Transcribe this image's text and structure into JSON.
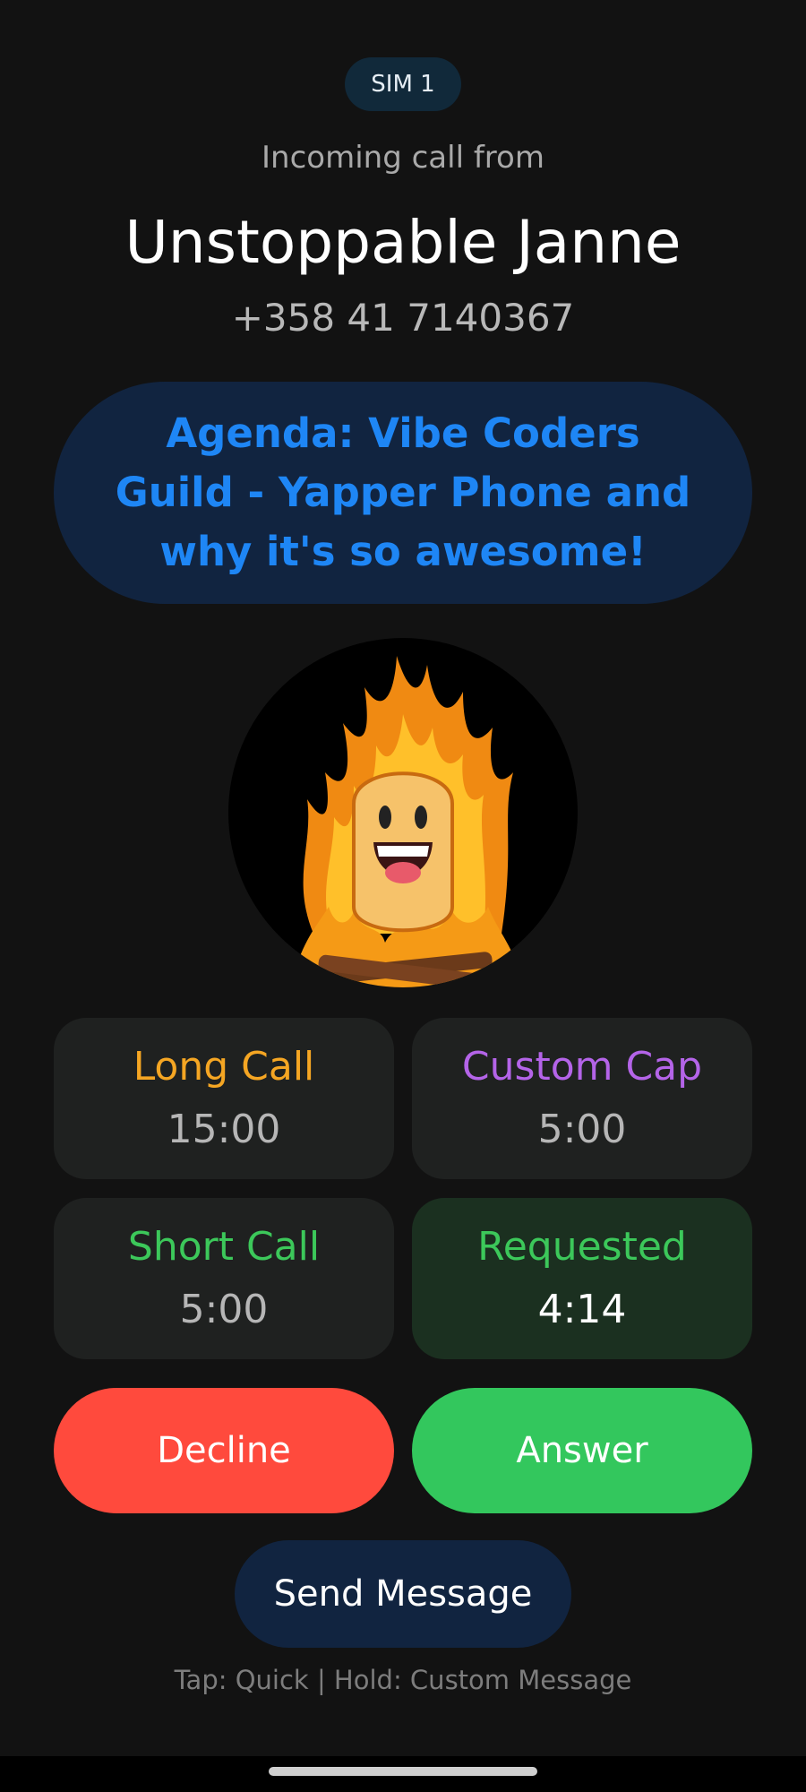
{
  "sim": {
    "label": "SIM 1"
  },
  "call": {
    "incoming_label": "Incoming call from",
    "caller_name": "Unstoppable Janne",
    "caller_number": "+358 41 7140367",
    "agenda": "Agenda: Vibe Coders Guild - Yapper Phone and why it's so awesome!"
  },
  "caps": [
    {
      "title": "Long Call",
      "time": "15:00",
      "color": "#f5a623"
    },
    {
      "title": "Custom Cap",
      "time": "5:00",
      "color": "#b464e8"
    },
    {
      "title": "Short Call",
      "time": "5:00",
      "color": "#3cc85a"
    },
    {
      "title": "Requested",
      "time": "4:14",
      "color": "#3cc85a",
      "selected": true
    }
  ],
  "actions": {
    "decline": "Decline",
    "answer": "Answer",
    "send_message": "Send Message"
  },
  "hint": "Tap: Quick | Hold: Custom Message",
  "colors": {
    "background": "#121212",
    "decline": "#ff4a3d",
    "answer": "#33c75d",
    "agenda_text": "#1e86f5",
    "agenda_bg": "#112440"
  },
  "avatar": {
    "icon": "flame-character-icon"
  }
}
